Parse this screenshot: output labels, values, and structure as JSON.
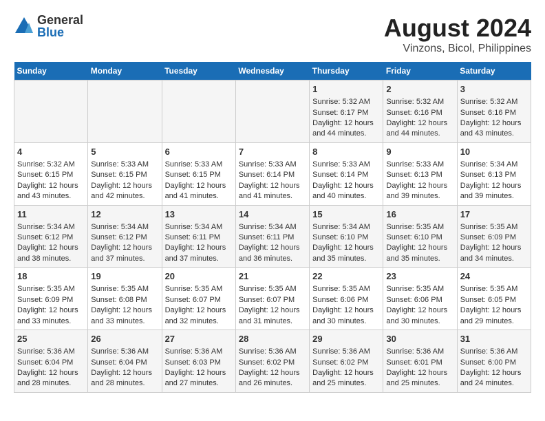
{
  "logo": {
    "general": "General",
    "blue": "Blue"
  },
  "title": "August 2024",
  "subtitle": "Vinzons, Bicol, Philippines",
  "weekdays": [
    "Sunday",
    "Monday",
    "Tuesday",
    "Wednesday",
    "Thursday",
    "Friday",
    "Saturday"
  ],
  "weeks": [
    [
      {
        "day": "",
        "content": ""
      },
      {
        "day": "",
        "content": ""
      },
      {
        "day": "",
        "content": ""
      },
      {
        "day": "",
        "content": ""
      },
      {
        "day": "1",
        "content": "Sunrise: 5:32 AM\nSunset: 6:17 PM\nDaylight: 12 hours and 44 minutes."
      },
      {
        "day": "2",
        "content": "Sunrise: 5:32 AM\nSunset: 6:16 PM\nDaylight: 12 hours and 44 minutes."
      },
      {
        "day": "3",
        "content": "Sunrise: 5:32 AM\nSunset: 6:16 PM\nDaylight: 12 hours and 43 minutes."
      }
    ],
    [
      {
        "day": "4",
        "content": "Sunrise: 5:32 AM\nSunset: 6:15 PM\nDaylight: 12 hours and 43 minutes."
      },
      {
        "day": "5",
        "content": "Sunrise: 5:33 AM\nSunset: 6:15 PM\nDaylight: 12 hours and 42 minutes."
      },
      {
        "day": "6",
        "content": "Sunrise: 5:33 AM\nSunset: 6:15 PM\nDaylight: 12 hours and 41 minutes."
      },
      {
        "day": "7",
        "content": "Sunrise: 5:33 AM\nSunset: 6:14 PM\nDaylight: 12 hours and 41 minutes."
      },
      {
        "day": "8",
        "content": "Sunrise: 5:33 AM\nSunset: 6:14 PM\nDaylight: 12 hours and 40 minutes."
      },
      {
        "day": "9",
        "content": "Sunrise: 5:33 AM\nSunset: 6:13 PM\nDaylight: 12 hours and 39 minutes."
      },
      {
        "day": "10",
        "content": "Sunrise: 5:34 AM\nSunset: 6:13 PM\nDaylight: 12 hours and 39 minutes."
      }
    ],
    [
      {
        "day": "11",
        "content": "Sunrise: 5:34 AM\nSunset: 6:12 PM\nDaylight: 12 hours and 38 minutes."
      },
      {
        "day": "12",
        "content": "Sunrise: 5:34 AM\nSunset: 6:12 PM\nDaylight: 12 hours and 37 minutes."
      },
      {
        "day": "13",
        "content": "Sunrise: 5:34 AM\nSunset: 6:11 PM\nDaylight: 12 hours and 37 minutes."
      },
      {
        "day": "14",
        "content": "Sunrise: 5:34 AM\nSunset: 6:11 PM\nDaylight: 12 hours and 36 minutes."
      },
      {
        "day": "15",
        "content": "Sunrise: 5:34 AM\nSunset: 6:10 PM\nDaylight: 12 hours and 35 minutes."
      },
      {
        "day": "16",
        "content": "Sunrise: 5:35 AM\nSunset: 6:10 PM\nDaylight: 12 hours and 35 minutes."
      },
      {
        "day": "17",
        "content": "Sunrise: 5:35 AM\nSunset: 6:09 PM\nDaylight: 12 hours and 34 minutes."
      }
    ],
    [
      {
        "day": "18",
        "content": "Sunrise: 5:35 AM\nSunset: 6:09 PM\nDaylight: 12 hours and 33 minutes."
      },
      {
        "day": "19",
        "content": "Sunrise: 5:35 AM\nSunset: 6:08 PM\nDaylight: 12 hours and 33 minutes."
      },
      {
        "day": "20",
        "content": "Sunrise: 5:35 AM\nSunset: 6:07 PM\nDaylight: 12 hours and 32 minutes."
      },
      {
        "day": "21",
        "content": "Sunrise: 5:35 AM\nSunset: 6:07 PM\nDaylight: 12 hours and 31 minutes."
      },
      {
        "day": "22",
        "content": "Sunrise: 5:35 AM\nSunset: 6:06 PM\nDaylight: 12 hours and 30 minutes."
      },
      {
        "day": "23",
        "content": "Sunrise: 5:35 AM\nSunset: 6:06 PM\nDaylight: 12 hours and 30 minutes."
      },
      {
        "day": "24",
        "content": "Sunrise: 5:35 AM\nSunset: 6:05 PM\nDaylight: 12 hours and 29 minutes."
      }
    ],
    [
      {
        "day": "25",
        "content": "Sunrise: 5:36 AM\nSunset: 6:04 PM\nDaylight: 12 hours and 28 minutes."
      },
      {
        "day": "26",
        "content": "Sunrise: 5:36 AM\nSunset: 6:04 PM\nDaylight: 12 hours and 28 minutes."
      },
      {
        "day": "27",
        "content": "Sunrise: 5:36 AM\nSunset: 6:03 PM\nDaylight: 12 hours and 27 minutes."
      },
      {
        "day": "28",
        "content": "Sunrise: 5:36 AM\nSunset: 6:02 PM\nDaylight: 12 hours and 26 minutes."
      },
      {
        "day": "29",
        "content": "Sunrise: 5:36 AM\nSunset: 6:02 PM\nDaylight: 12 hours and 25 minutes."
      },
      {
        "day": "30",
        "content": "Sunrise: 5:36 AM\nSunset: 6:01 PM\nDaylight: 12 hours and 25 minutes."
      },
      {
        "day": "31",
        "content": "Sunrise: 5:36 AM\nSunset: 6:00 PM\nDaylight: 12 hours and 24 minutes."
      }
    ]
  ]
}
